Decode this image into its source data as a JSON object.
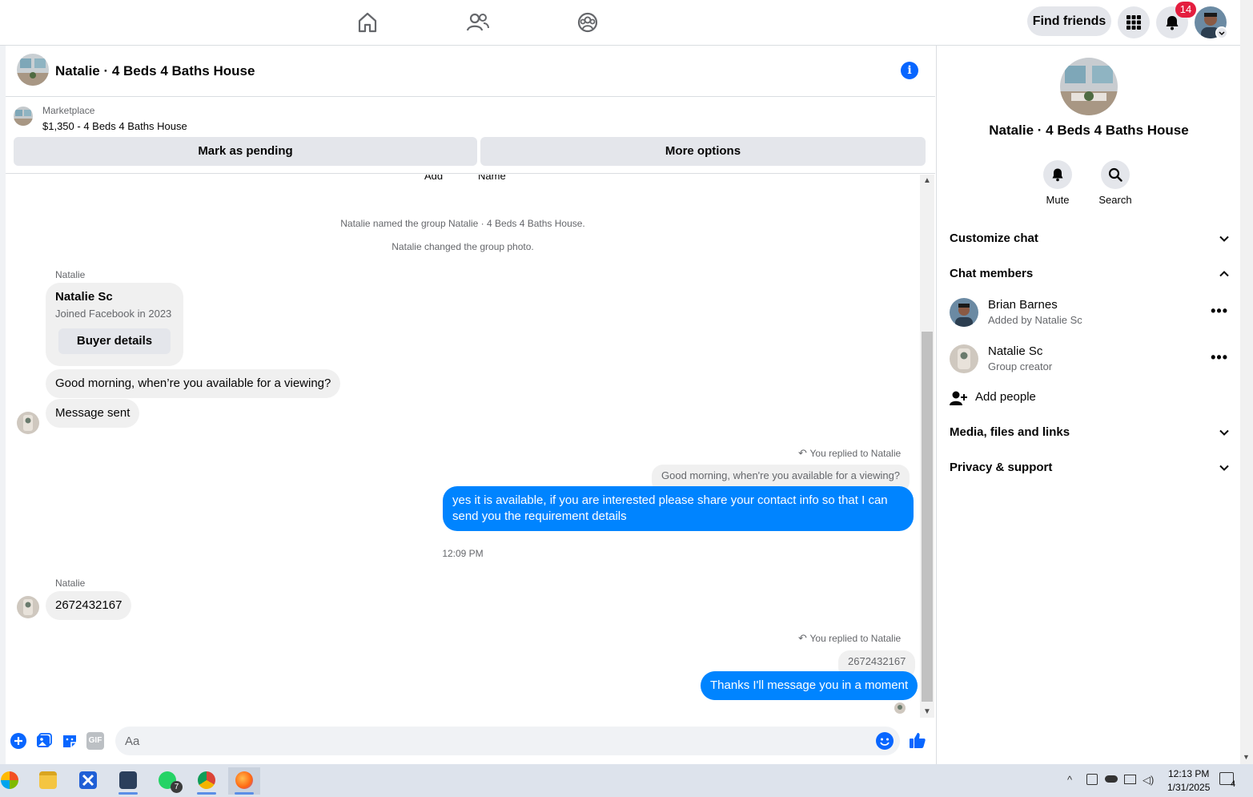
{
  "topbar": {
    "find_friends": "Find friends",
    "notifications_count": "14"
  },
  "chat": {
    "title": "Natalie · 4 Beds 4 Baths House"
  },
  "marketplace": {
    "label": "Marketplace",
    "price_title": "$1,350 - 4 Beds 4 Baths House",
    "mark_pending": "Mark as pending",
    "more_options": "More options"
  },
  "messages": {
    "clipped_add": "Add",
    "clipped_name": "Name",
    "sys1": "Natalie named the group Natalie · 4 Beds 4 Baths House.",
    "sys2": "Natalie changed the group photo.",
    "sender1": "Natalie",
    "card_name": "Natalie Sc",
    "card_joined": "Joined Facebook in 2023",
    "card_button": "Buyer details",
    "msg1": "Good morning, when’re you available for a viewing?",
    "msg2": "Message sent",
    "reply_tag1": "You replied to Natalie",
    "quote1": "Good morning, when're you available for a viewing?",
    "out1": "yes it is available, if you are interested please share your contact info so that I can send you the requirement details",
    "time1": "12:09 PM",
    "sender2": "Natalie",
    "msg3": "2672432167",
    "reply_tag2": "You replied to Natalie",
    "quote2": "2672432167",
    "out2": "Thanks I'll message you in a moment"
  },
  "composer": {
    "placeholder": "Aa",
    "gif_label": "GIF"
  },
  "right_panel": {
    "title": "Natalie · 4 Beds 4 Baths House",
    "mute": "Mute",
    "search": "Search",
    "customize_chat": "Customize chat",
    "chat_members": "Chat members",
    "members": [
      {
        "name": "Brian Barnes",
        "sub": "Added by Natalie Sc"
      },
      {
        "name": "Natalie Sc",
        "sub": "Group creator"
      }
    ],
    "add_people": "Add people",
    "media": "Media, files and links",
    "privacy": "Privacy & support"
  },
  "taskbar": {
    "time": "12:13 PM",
    "date": "1/31/2025",
    "whatsapp_badge": "7",
    "notif_count": "4"
  },
  "colors": {
    "accent": "#0084ff",
    "badge": "#e41e3f",
    "bubble_in": "#f0f0f0"
  }
}
